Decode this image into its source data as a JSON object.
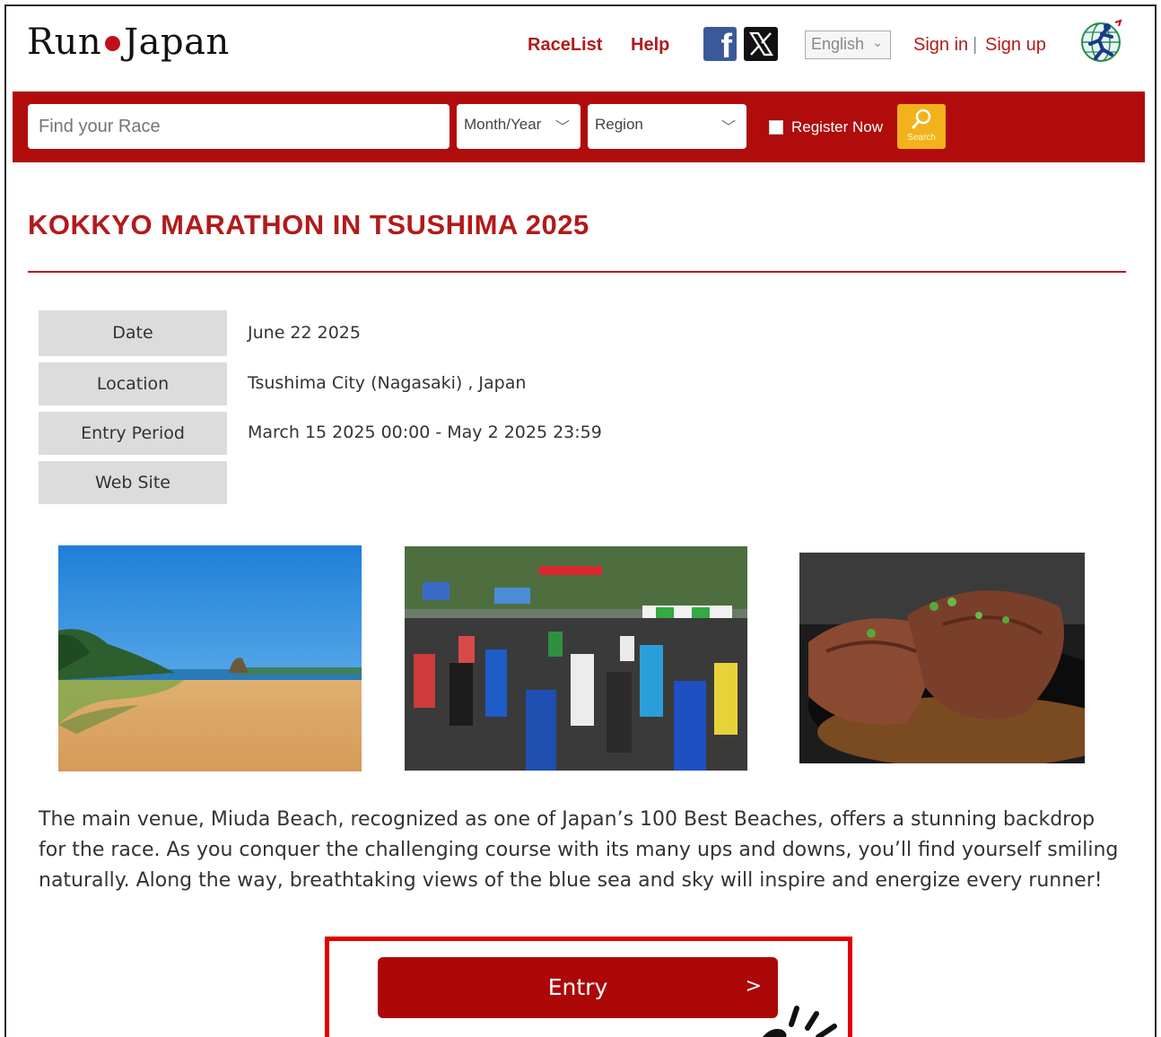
{
  "header": {
    "logo_left": "Run",
    "logo_right": "Japan",
    "nav": {
      "racelist": "RaceList",
      "help": "Help"
    },
    "social": {
      "facebook_glyph": "f"
    },
    "language": "English",
    "signin": "Sign in",
    "separator": "|",
    "signup": "Sign up"
  },
  "searchbar": {
    "placeholder": "Find your Race",
    "month_year": "Month/Year",
    "region": "Region",
    "register_now": "Register Now",
    "search_label": "Search"
  },
  "race": {
    "title": "KOKKYO MARATHON IN TSUSHIMA 2025",
    "info": [
      {
        "label": "Date",
        "value": "June 22 2025"
      },
      {
        "label": "Location",
        "value": "Tsushima City (Nagasaki) , Japan"
      },
      {
        "label": "Entry Period",
        "value": "March 15 2025 00:00 - May 2 2025 23:59"
      },
      {
        "label": "Web Site",
        "value": ""
      }
    ],
    "description": "The main venue, Miuda Beach, recognized as one of Japan’s 100 Best Beaches, offers a stunning backdrop for the race. As you conquer the challenging course with its many ups and downs, you’ll find yourself smiling naturally. Along the way, breathtaking views of the blue sea and sky will inspire and energize every runner!",
    "entry_button": "Entry",
    "entry_arrow": ">"
  },
  "colors": {
    "brand_red": "#b00c0c",
    "link_red": "#b21a1a",
    "search_yellow": "#f2b21b",
    "highlight_red": "#e00000"
  }
}
